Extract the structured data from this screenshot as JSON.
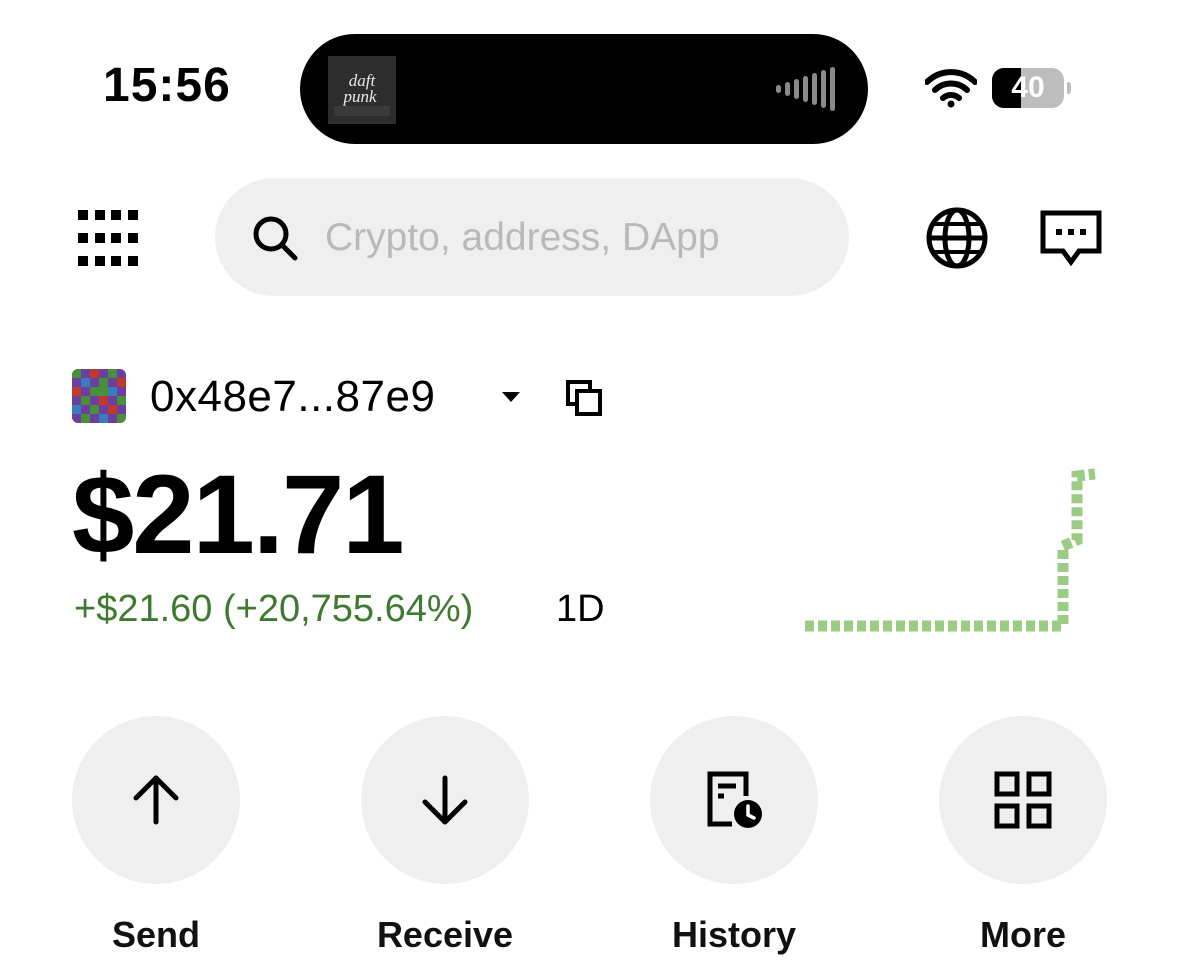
{
  "status_bar": {
    "time": "15:56",
    "battery_level": "40",
    "now_playing_art_text": "daft punk"
  },
  "header": {
    "search_placeholder": "Crypto, address, DApp"
  },
  "account": {
    "address": "0x48e7...87e9"
  },
  "portfolio": {
    "balance": "$21.71",
    "change": "+$21.60 (+20,755.64%)",
    "change_color": "#3e7a2f",
    "period": "1D"
  },
  "sparkline_color": "#9ccc84",
  "actions": [
    {
      "label": "Send",
      "icon": "arrow-up-icon"
    },
    {
      "label": "Receive",
      "icon": "arrow-down-icon"
    },
    {
      "label": "History",
      "icon": "history-icon"
    },
    {
      "label": "More",
      "icon": "grid-icon"
    }
  ]
}
